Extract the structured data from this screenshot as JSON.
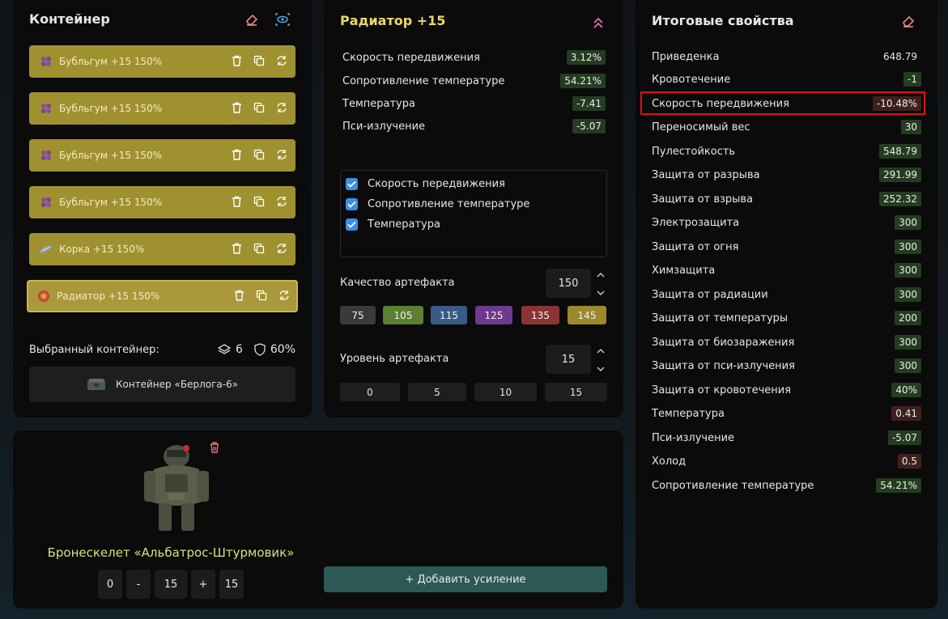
{
  "container": {
    "title": "Контейнер",
    "slots": [
      {
        "label": "Бубльгум +15 150%",
        "icon": "bubblegum-icon"
      },
      {
        "label": "Бубльгум +15 150%",
        "icon": "bubblegum-icon"
      },
      {
        "label": "Бубльгум +15 150%",
        "icon": "bubblegum-icon"
      },
      {
        "label": "Бубльгум +15 150%",
        "icon": "bubblegum-icon"
      },
      {
        "label": "Корка +15 150%",
        "icon": "crust-icon"
      },
      {
        "label": "Радиатор +15 150%",
        "icon": "radiator-icon"
      }
    ],
    "selected_label": "Выбранный контейнер:",
    "slots_count": "6",
    "protection": "60%",
    "container_name": "Контейнер «Берлога-6»"
  },
  "artifact": {
    "title": "Радиатор +15",
    "stats": [
      {
        "name": "Скорость передвижения",
        "value": "3.12%"
      },
      {
        "name": "Сопротивление температуре",
        "value": "54.21%"
      },
      {
        "name": "Температура",
        "value": "-7.41"
      },
      {
        "name": "Пси-излучение",
        "value": "-5.07"
      }
    ],
    "checks": [
      {
        "label": "Скорость передвижения"
      },
      {
        "label": "Сопротивление температуре"
      },
      {
        "label": "Температура"
      }
    ],
    "quality_label": "Качество артефакта",
    "quality_value": "150",
    "quality_options": [
      {
        "label": "75",
        "color": "#3a3a3a"
      },
      {
        "label": "105",
        "color": "#5b7f33"
      },
      {
        "label": "115",
        "color": "#3a5a87"
      },
      {
        "label": "125",
        "color": "#6d3a8e"
      },
      {
        "label": "135",
        "color": "#8a3434"
      },
      {
        "label": "145",
        "color": "#9a8a2a"
      }
    ],
    "level_label": "Уровень артефакта",
    "level_value": "15",
    "level_options": [
      "0",
      "5",
      "10",
      "15"
    ]
  },
  "props": {
    "title": "Итоговые свойства",
    "items": [
      {
        "name": "Приведенка",
        "value": "648.79",
        "tone": "n"
      },
      {
        "name": "Кровотечение",
        "value": "-1",
        "tone": "g"
      },
      {
        "name": "Скорость передвижения",
        "value": "-10.48%",
        "tone": "r"
      },
      {
        "name": "Переносимый вес",
        "value": "30",
        "tone": "g"
      },
      {
        "name": "Пулестойкость",
        "value": "548.79",
        "tone": "g"
      },
      {
        "name": "Защита от разрыва",
        "value": "291.99",
        "tone": "g"
      },
      {
        "name": "Защита от взрыва",
        "value": "252.32",
        "tone": "g"
      },
      {
        "name": "Электрозащита",
        "value": "300",
        "tone": "g"
      },
      {
        "name": "Защита от огня",
        "value": "300",
        "tone": "g"
      },
      {
        "name": "Химзащита",
        "value": "300",
        "tone": "g"
      },
      {
        "name": "Защита от радиации",
        "value": "300",
        "tone": "g"
      },
      {
        "name": "Защита от температуры",
        "value": "200",
        "tone": "g"
      },
      {
        "name": "Защита от биозаражения",
        "value": "300",
        "tone": "g"
      },
      {
        "name": "Защита от пси-излучения",
        "value": "300",
        "tone": "g"
      },
      {
        "name": "Защита от кровотечения",
        "value": "40%",
        "tone": "g"
      },
      {
        "name": "Температура",
        "value": "0.41",
        "tone": "r"
      },
      {
        "name": "Пси-излучение",
        "value": "-5.07",
        "tone": "g"
      },
      {
        "name": "Холод",
        "value": "0.5",
        "tone": "r"
      },
      {
        "name": "Сопротивление температуре",
        "value": "54.21%",
        "tone": "g"
      }
    ]
  },
  "armor": {
    "name": "Бронескелет «Альбатрос-Штурмовик»",
    "min": "0",
    "minus": "-",
    "level": "15",
    "plus": "+",
    "max": "15",
    "add_label": "+ Добавить усиление"
  },
  "colors": {
    "accent_yellow": "#e8d96a",
    "slot_bg": "#a09130",
    "positive": "#243c22",
    "negative": "#3f201f",
    "highlight": "#e01010"
  }
}
